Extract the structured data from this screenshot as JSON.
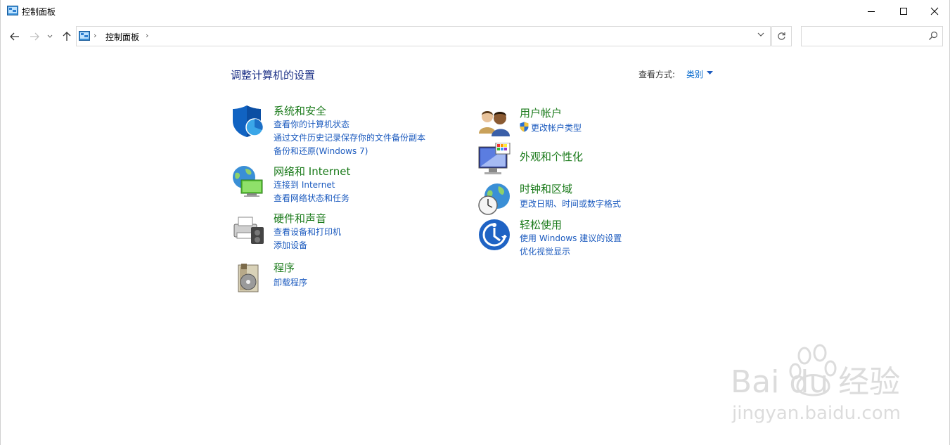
{
  "window": {
    "title": "控制面板"
  },
  "address": {
    "crumb": "控制面板",
    "search_placeholder": ""
  },
  "main": {
    "heading": "调整计算机的设置",
    "view_by_label": "查看方式:",
    "view_by_value": "类别"
  },
  "categories": {
    "system_security": {
      "title": "系统和安全",
      "links": [
        "查看你的计算机状态",
        "通过文件历史记录保存你的文件备份副本",
        "备份和还原(Windows 7)"
      ]
    },
    "network": {
      "title": "网络和 Internet",
      "links": [
        "连接到 Internet",
        "查看网络状态和任务"
      ]
    },
    "hardware": {
      "title": "硬件和声音",
      "links": [
        "查看设备和打印机",
        "添加设备"
      ]
    },
    "programs": {
      "title": "程序",
      "links": [
        "卸载程序"
      ]
    },
    "user_accounts": {
      "title": "用户帐户",
      "links": [
        "更改帐户类型"
      ]
    },
    "appearance": {
      "title": "外观和个性化",
      "links": []
    },
    "clock_region": {
      "title": "时钟和区域",
      "links": [
        "更改日期、时间或数字格式"
      ]
    },
    "ease_of_access": {
      "title": "轻松使用",
      "links": [
        "使用 Windows 建议的设置",
        "优化视觉显示"
      ]
    }
  },
  "watermark": {
    "brand": "Bai du 经验",
    "url": "jingyan.baidu.com"
  },
  "colors": {
    "heading": "#1e3287",
    "category_title": "#1a7a1a",
    "link": "#1c5bbf"
  },
  "icons": [
    "control-panel-icon",
    "back-arrow-icon",
    "forward-arrow-icon",
    "up-arrow-icon",
    "refresh-icon",
    "search-icon",
    "shield-icon",
    "globe-network-icon",
    "printer-icon",
    "programs-box-icon",
    "users-icon",
    "monitor-palette-icon",
    "clock-globe-icon",
    "ease-of-access-icon"
  ]
}
